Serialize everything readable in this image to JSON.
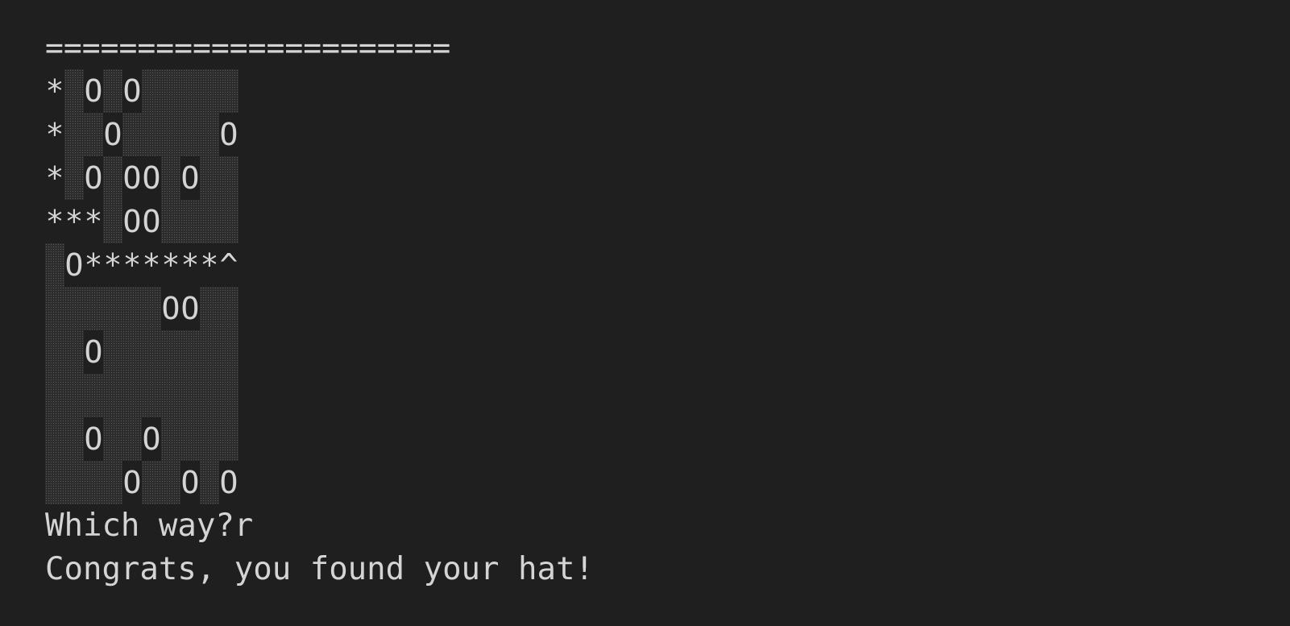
{
  "terminal": {
    "separator": "======================",
    "legend": {
      "path": "*",
      "hole": "O",
      "hat": "^",
      "field": "░"
    },
    "grid": [
      "*░O░O░░░░░",
      "*░░O░░░░░O",
      "*░O░OO░O░░",
      "***░OO░░░░",
      "░O*******^",
      "░░░░░░OO░░",
      "░░O░░░░░░░",
      "░░░░░░░░░░",
      "░░O░░O░░░░",
      "░░░░O░░O░O"
    ],
    "prompt": "Which way?r",
    "result": "Congrats, you found your hat!"
  },
  "colors": {
    "background": "#1f1f1f",
    "text": "#d4d4d4",
    "field": "#2c2c2c"
  }
}
